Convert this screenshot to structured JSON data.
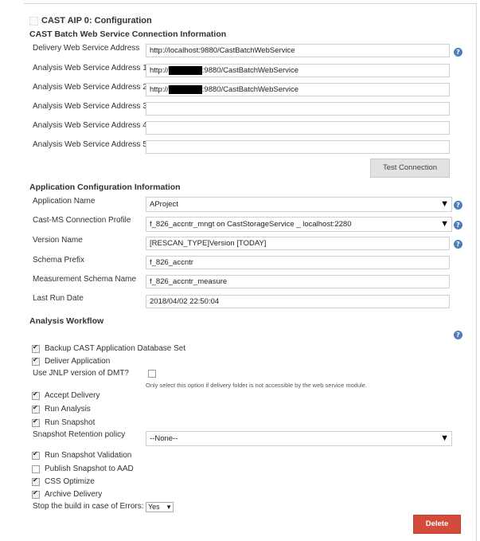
{
  "section": {
    "title": "CAST AIP 0: Configuration"
  },
  "batch": {
    "heading": "CAST Batch Web Service Connection Information",
    "fields": [
      {
        "label": "Delivery Web Service Address",
        "value": "http://localhost:9880/CastBatchWebService"
      },
      {
        "label": "Analysis Web Service Address 1",
        "value_prefix": "http://",
        "value_suffix": ":9880/CastBatchWebService"
      },
      {
        "label": "Analysis Web Service Address 2",
        "value_prefix": "http://",
        "value_suffix": ":9880/CastBatchWebService"
      },
      {
        "label": "Analysis Web Service Address 3",
        "value": ""
      },
      {
        "label": "Analysis Web Service Address 4",
        "value": ""
      },
      {
        "label": "Analysis Web Service Address 5",
        "value": ""
      }
    ],
    "test_button": "Test Connection"
  },
  "app_config": {
    "heading": "Application Configuration Information",
    "application_name": {
      "label": "Application Name",
      "value": "AProject"
    },
    "cast_ms_profile": {
      "label": "Cast-MS Connection Profile",
      "value": "f_826_accntr_mngt on CastStorageService _ localhost:2280"
    },
    "version_name": {
      "label": "Version Name",
      "value": "[RESCAN_TYPE]Version [TODAY]"
    },
    "schema_prefix": {
      "label": "Schema Prefix",
      "value": "f_826_accntr"
    },
    "measurement_schema": {
      "label": "Measurement Schema Name",
      "value": "f_826_accntr_measure"
    },
    "last_run_date": {
      "label": "Last Run Date",
      "value": "2018/04/02 22:50:04"
    }
  },
  "workflow": {
    "heading": "Analysis Workflow",
    "backup": {
      "label": "Backup CAST Application Database Set",
      "checked": true
    },
    "deliver": {
      "label": "Deliver Application",
      "checked": true
    },
    "jnlp": {
      "label": "Use JNLP version of DMT?",
      "checked": false,
      "note": "Only select this option if delivery folder is not accessible by the web service module."
    },
    "accept": {
      "label": "Accept Delivery",
      "checked": true
    },
    "run_analysis": {
      "label": "Run Analysis",
      "checked": true
    },
    "run_snapshot": {
      "label": "Run Snapshot",
      "checked": true
    },
    "retention": {
      "label": "Snapshot Retention policy",
      "value": "--None--"
    },
    "snapshot_validation": {
      "label": "Run Snapshot Validation",
      "checked": true
    },
    "publish_aad": {
      "label": "Publish Snapshot to AAD",
      "checked": false
    },
    "css_optimize": {
      "label": "CSS Optimize",
      "checked": true
    },
    "archive": {
      "label": "Archive Delivery",
      "checked": true
    },
    "stop_build": {
      "label": "Stop the build in case of Errors:",
      "value": "Yes"
    },
    "delete_button": "Delete"
  },
  "icons": {
    "help": "help-icon",
    "dropdown": "triangle-down-icon",
    "check": "checkmark-icon"
  },
  "colors": {
    "help_icon": "#4f7fb8",
    "delete_button": "#d54b3b",
    "test_button": "#e2e2e2"
  }
}
